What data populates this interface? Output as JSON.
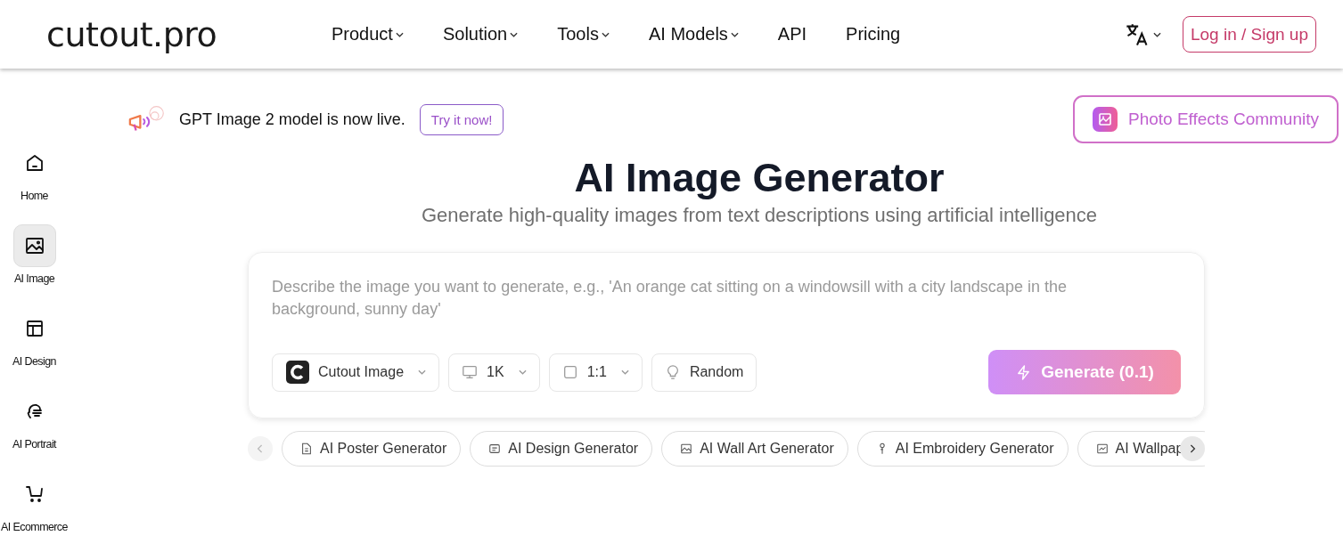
{
  "header": {
    "logo": "cutout.pro",
    "nav": [
      {
        "label": "Product",
        "dropdown": true
      },
      {
        "label": "Solution",
        "dropdown": true
      },
      {
        "label": "Tools",
        "dropdown": true
      },
      {
        "label": "AI Models",
        "dropdown": true
      },
      {
        "label": "API",
        "dropdown": false
      },
      {
        "label": "Pricing",
        "dropdown": false
      }
    ],
    "login": "Log in / Sign up"
  },
  "sidebar": {
    "items": [
      {
        "label": "Home",
        "selected": false
      },
      {
        "label": "AI Image",
        "selected": true
      },
      {
        "label": "AI Design",
        "selected": false
      },
      {
        "label": "AI Portrait",
        "selected": false
      },
      {
        "label": "AI Ecommerce",
        "selected": false
      }
    ]
  },
  "announcement": {
    "text": "GPT Image 2 model is now live.",
    "button": "Try it now!"
  },
  "community_button": "Photo Effects Community",
  "title": "AI Image Generator",
  "subtitle": "Generate high-quality images from text descriptions using artificial intelligence",
  "prompt": {
    "placeholder": "Describe the image you want to generate, e.g., 'An orange cat sitting on a windowsill with a city landscape in the background, sunny day'"
  },
  "options": [
    {
      "kind": "model",
      "label": "Cutout Image"
    },
    {
      "kind": "resolution",
      "label": "1K"
    },
    {
      "kind": "ratio",
      "label": "1:1"
    },
    {
      "kind": "random",
      "label": "Random"
    }
  ],
  "generate_button": "Generate (0.1)",
  "chips": [
    {
      "label": "AI Poster Generator"
    },
    {
      "label": "AI Design Generator"
    },
    {
      "label": "AI Wall Art Generator"
    },
    {
      "label": "AI Embroidery Generator"
    },
    {
      "label": "AI Wallpap"
    }
  ]
}
